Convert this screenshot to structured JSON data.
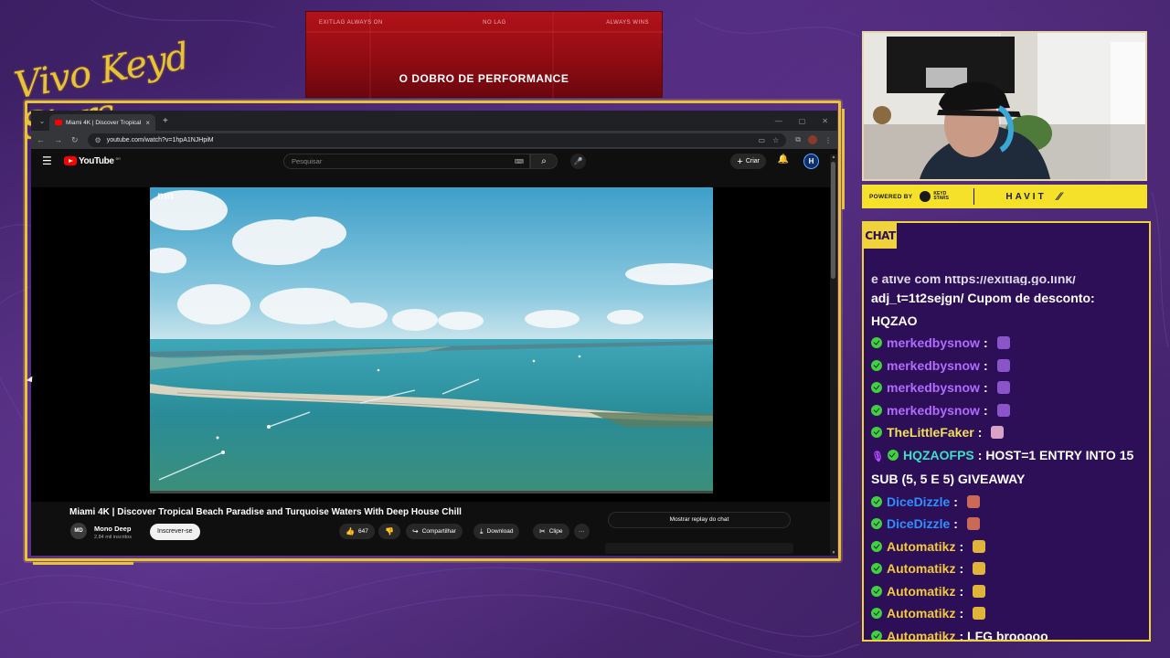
{
  "stream": {
    "logo_text": "Vivo Keyd Stars"
  },
  "banner": {
    "top_left": "EXITLAG ALWAYS ON",
    "top_center": "NO LAG",
    "top_right": "ALWAYS WINS",
    "headline": "O DOBRO DE PERFORMANCE"
  },
  "browser": {
    "tab_title": "Miami 4K | Discover Tropical Be",
    "url": "youtube.com/watch?v=1hpA1NJHpiM"
  },
  "youtube": {
    "logo": "YouTube",
    "logo_country": "BR",
    "search_placeholder": "Pesquisar",
    "create_label": "Criar",
    "user_initial": "H",
    "video_title": "Miami 4K | Discover Tropical Beach Paradise and Turquoise Waters With Deep House Chill",
    "watermark": "mn",
    "channel_initials": "MD",
    "channel_name": "Mono Deep",
    "channel_subs": "2,84 mil inscritos",
    "subscribe_label": "Inscrever-se",
    "like_count": "647",
    "share_label": "Compartilhar",
    "download_label": "Download",
    "clip_label": "Clipe",
    "more_label": "···",
    "replay_label": "Mostrar replay do chat"
  },
  "sponsor": {
    "powered_by": "POWERED BY",
    "keyd_line1": "KEYD",
    "keyd_line2": "STARS",
    "brand": "HAVIT"
  },
  "chat": {
    "tag": "CHAT",
    "cut_line": "e ative com https://exitlag.go.link/",
    "intro_lines": [
      "adj_t=1t2sejgn/ Cupom de desconto:",
      "HQZAO"
    ],
    "messages": [
      {
        "user": "merkedbysnow",
        "color": "#b06bff",
        "text": "",
        "emote": "#8a55c9",
        "badge": "check"
      },
      {
        "user": "merkedbysnow",
        "color": "#b06bff",
        "text": "",
        "emote": "#8a55c9",
        "badge": "check"
      },
      {
        "user": "merkedbysnow",
        "color": "#b06bff",
        "text": "",
        "emote": "#8a55c9",
        "badge": "check"
      },
      {
        "user": "merkedbysnow",
        "color": "#b06bff",
        "text": "",
        "emote": "#8a55c9",
        "badge": "check"
      },
      {
        "user": "TheLittleFaker",
        "color": "#f1e05a",
        "text": "",
        "emote": "#d9a3c7",
        "badge": "check"
      },
      {
        "user": "HQZAOFPS",
        "color": "#3ce0c3",
        "text": "HOST=1 ENTRY INTO 15 SUB (5, 5 E 5) GIVEAWAY",
        "emote": "",
        "badge": "mic+check"
      },
      {
        "user": "DiceDizzle",
        "color": "#2f8fff",
        "text": "",
        "emote": "#c96a58",
        "badge": "check"
      },
      {
        "user": "DiceDizzle",
        "color": "#2f8fff",
        "text": "",
        "emote": "#c96a58",
        "badge": "check"
      },
      {
        "user": "Automatikz",
        "color": "#f1c93a",
        "text": "",
        "emote": "#e0b33a",
        "badge": "check"
      },
      {
        "user": "Automatikz",
        "color": "#f1c93a",
        "text": "",
        "emote": "#e0b33a",
        "badge": "check"
      },
      {
        "user": "Automatikz",
        "color": "#f1c93a",
        "text": "",
        "emote": "#e0b33a",
        "badge": "check"
      },
      {
        "user": "Automatikz",
        "color": "#f1c93a",
        "text": "",
        "emote": "#e0b33a",
        "badge": "check"
      },
      {
        "user": "Automatikz",
        "color": "#f1c93a",
        "text": "LFG brooooo",
        "emote": "",
        "badge": "check"
      }
    ]
  }
}
